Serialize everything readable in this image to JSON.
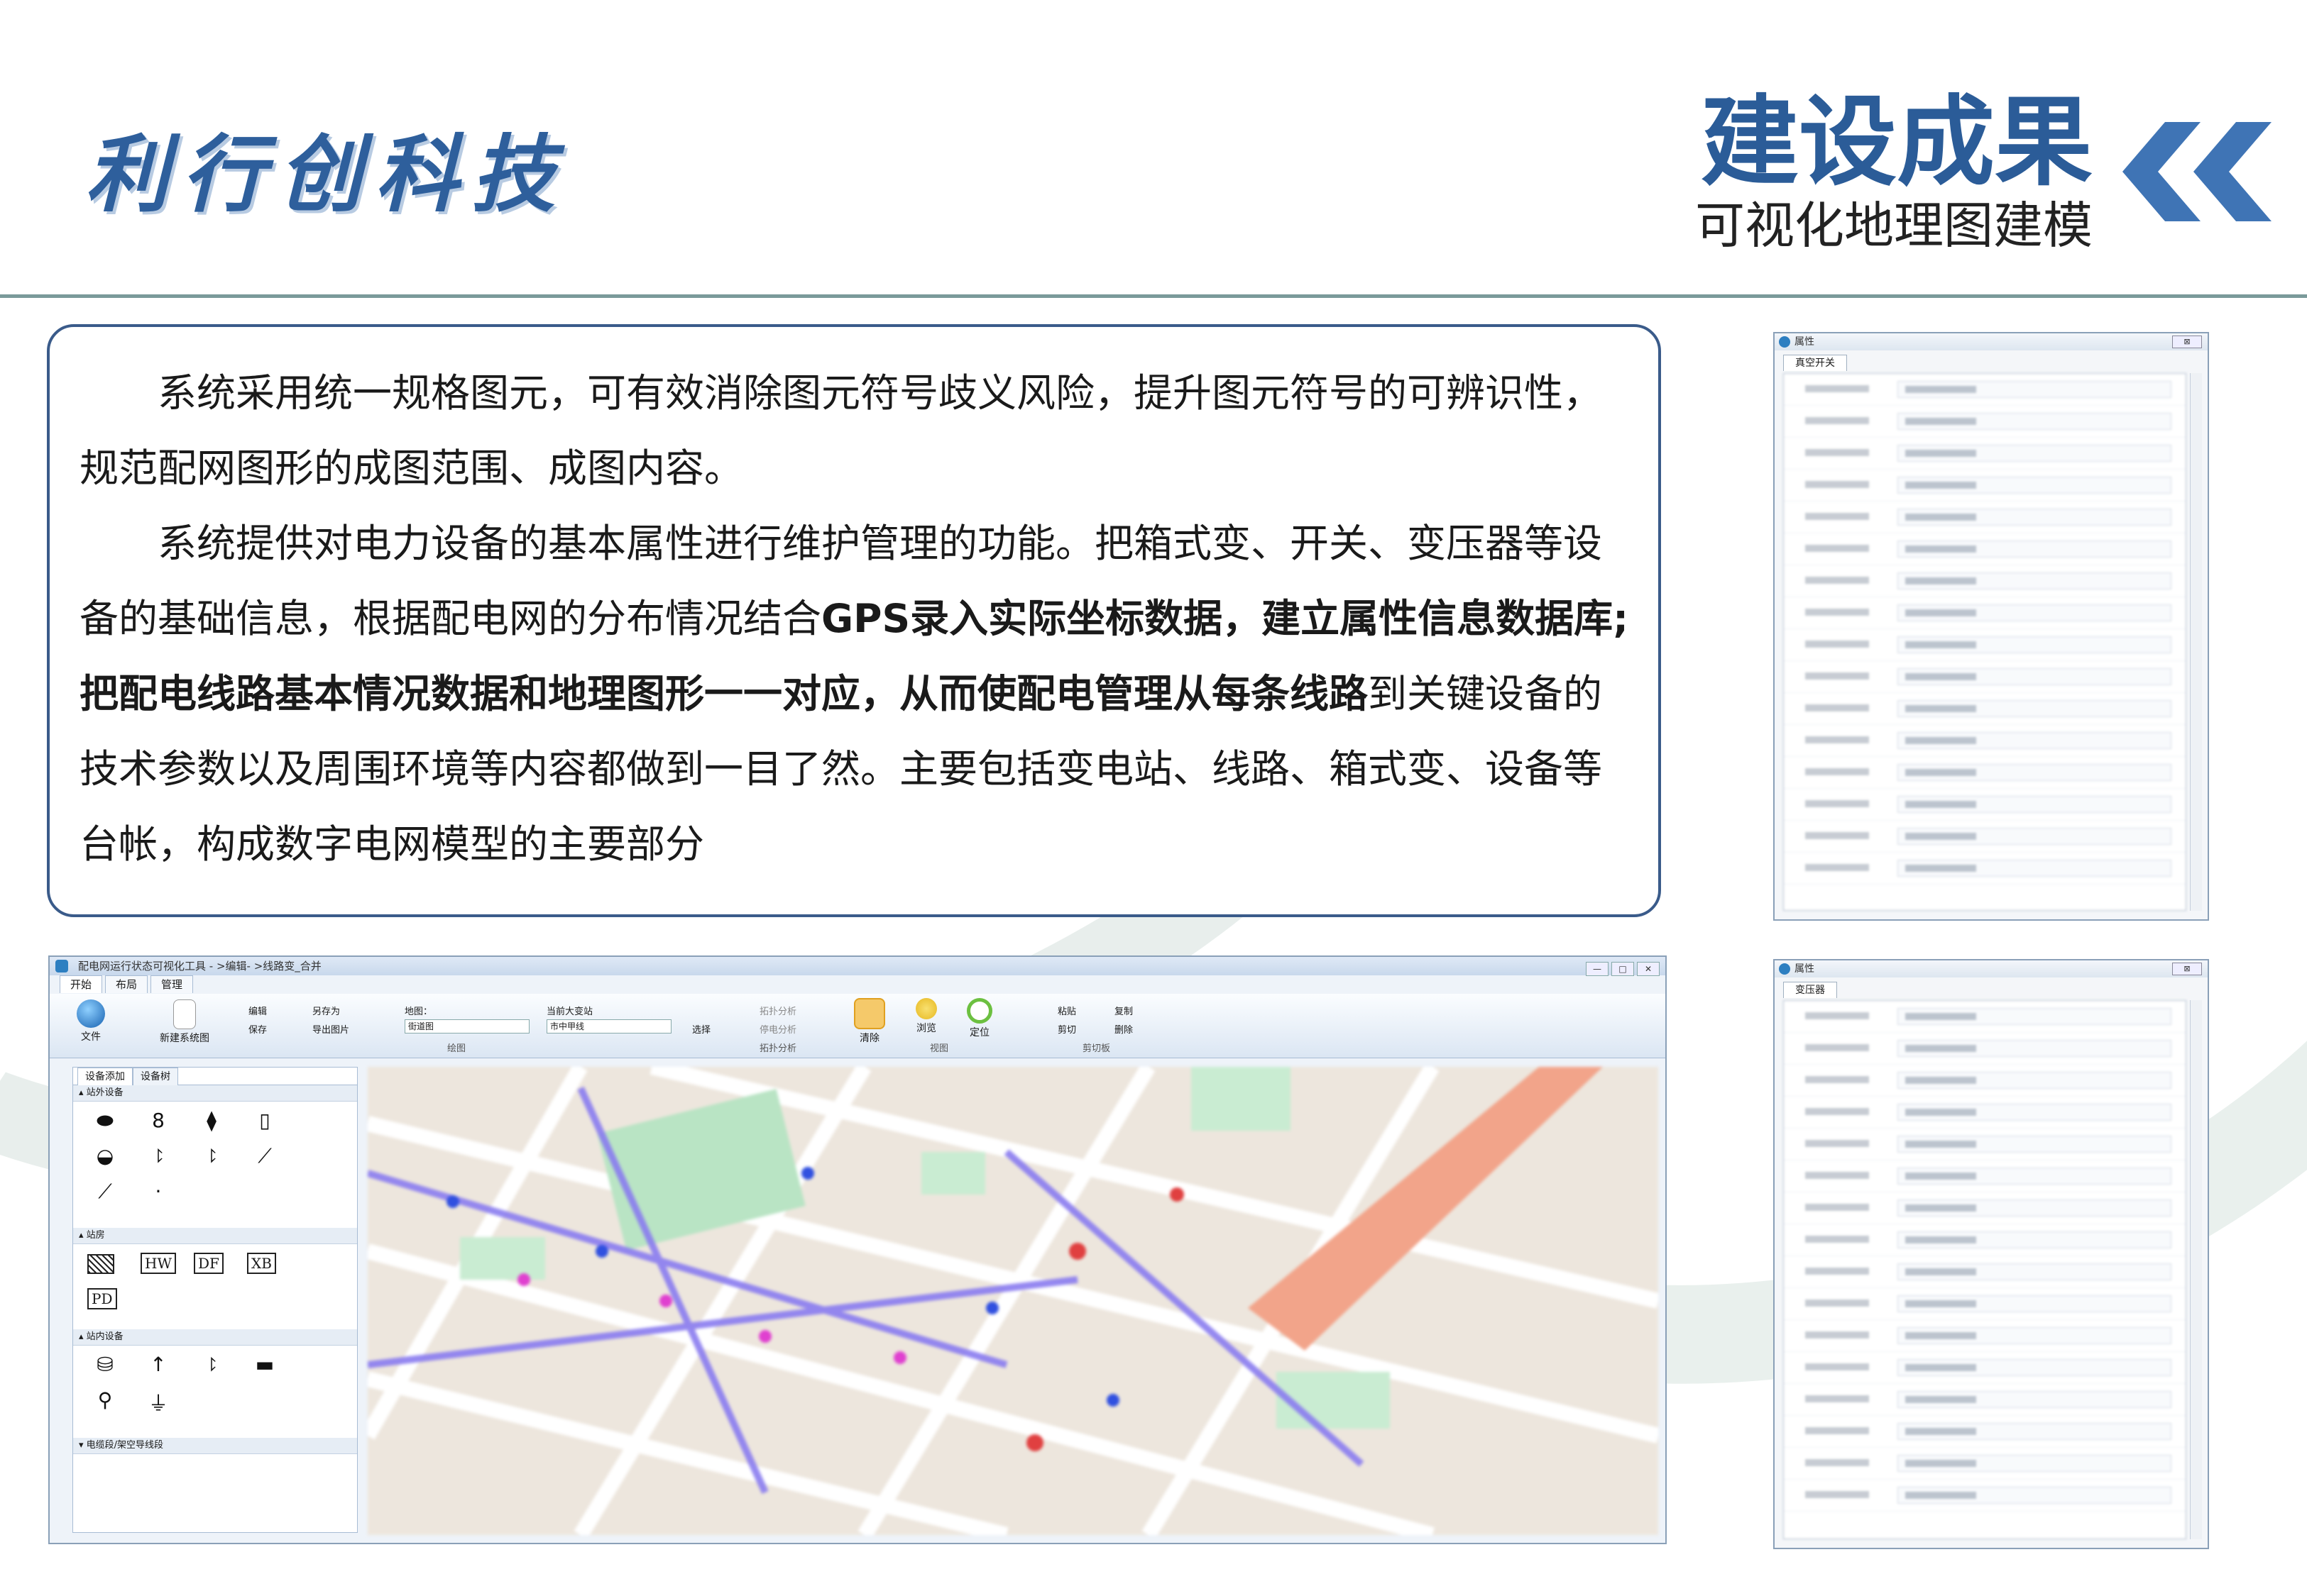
{
  "header": {
    "logo_text": "利行创科技",
    "title": "建设成果",
    "subtitle": "可视化地理图建模"
  },
  "colors": {
    "brand_blue": "#2b5c98",
    "divider": "#7a9a9a",
    "box_border": "#3a5b8a",
    "chevron": "#3f74b5"
  },
  "body": {
    "para1": "系统采用统一规格图元，可有效消除图元符号歧义风险，提升图元符号的可辨识性，规范配网图形的成图范围、成图内容。",
    "para2_a": "系统提供对电力设备的基本属性进行维护管理的功能。把箱式变、开关、变压器等设备的基础信息，根据配电网的分布情况结合",
    "para2_b": "GPS录入实际坐标数据，建立属性信息数据库;把配电线路基本情况数据和地理图形一一对应，从而使配电管理从每条线路",
    "para2_c": "到关键设备的技术参数以及周围环境等内容都做到一目了然。主要包括变电站、线路、箱式变、设备等台帐，构成数字电网模型的主要部分"
  },
  "app": {
    "window_title": "配电网运行状态可视化工具 - >编辑- >线路变_合并",
    "tabs": [
      "开始",
      "布局",
      "管理"
    ],
    "ribbon": {
      "file_group": "文件",
      "new_label": "新建系统图",
      "edit": "编辑",
      "save_as": "另存为",
      "save": "保存",
      "export_img": "导出图片",
      "region_label": "地图：",
      "region_value": "街道图",
      "substation_label": "当前大变站",
      "substation_value": "市中甲线",
      "draw_group": "绘图",
      "select": "选择",
      "topo1": "拓扑分析",
      "topo2": "停电分析",
      "topo_group": "拓扑分析",
      "clear": "清除",
      "browse": "浏览",
      "locate": "定位",
      "view_group": "视图",
      "paste": "粘贴",
      "copy": "复制",
      "cut": "剪切",
      "delete": "删除",
      "clip_group": "剪切板"
    },
    "panel": {
      "tabs": [
        "设备添加",
        "设备树"
      ],
      "groups": [
        "站外设备",
        "站房",
        "站内设备",
        "电缆段/架空导线段"
      ],
      "station_labels": [
        "HW",
        "DF",
        "XB",
        "PD"
      ]
    }
  },
  "dialog1": {
    "title": "属性",
    "tab": "真空开关",
    "close": "⊠"
  },
  "dialog2": {
    "title": "属性",
    "tab": "变压器",
    "close": "⊠"
  }
}
